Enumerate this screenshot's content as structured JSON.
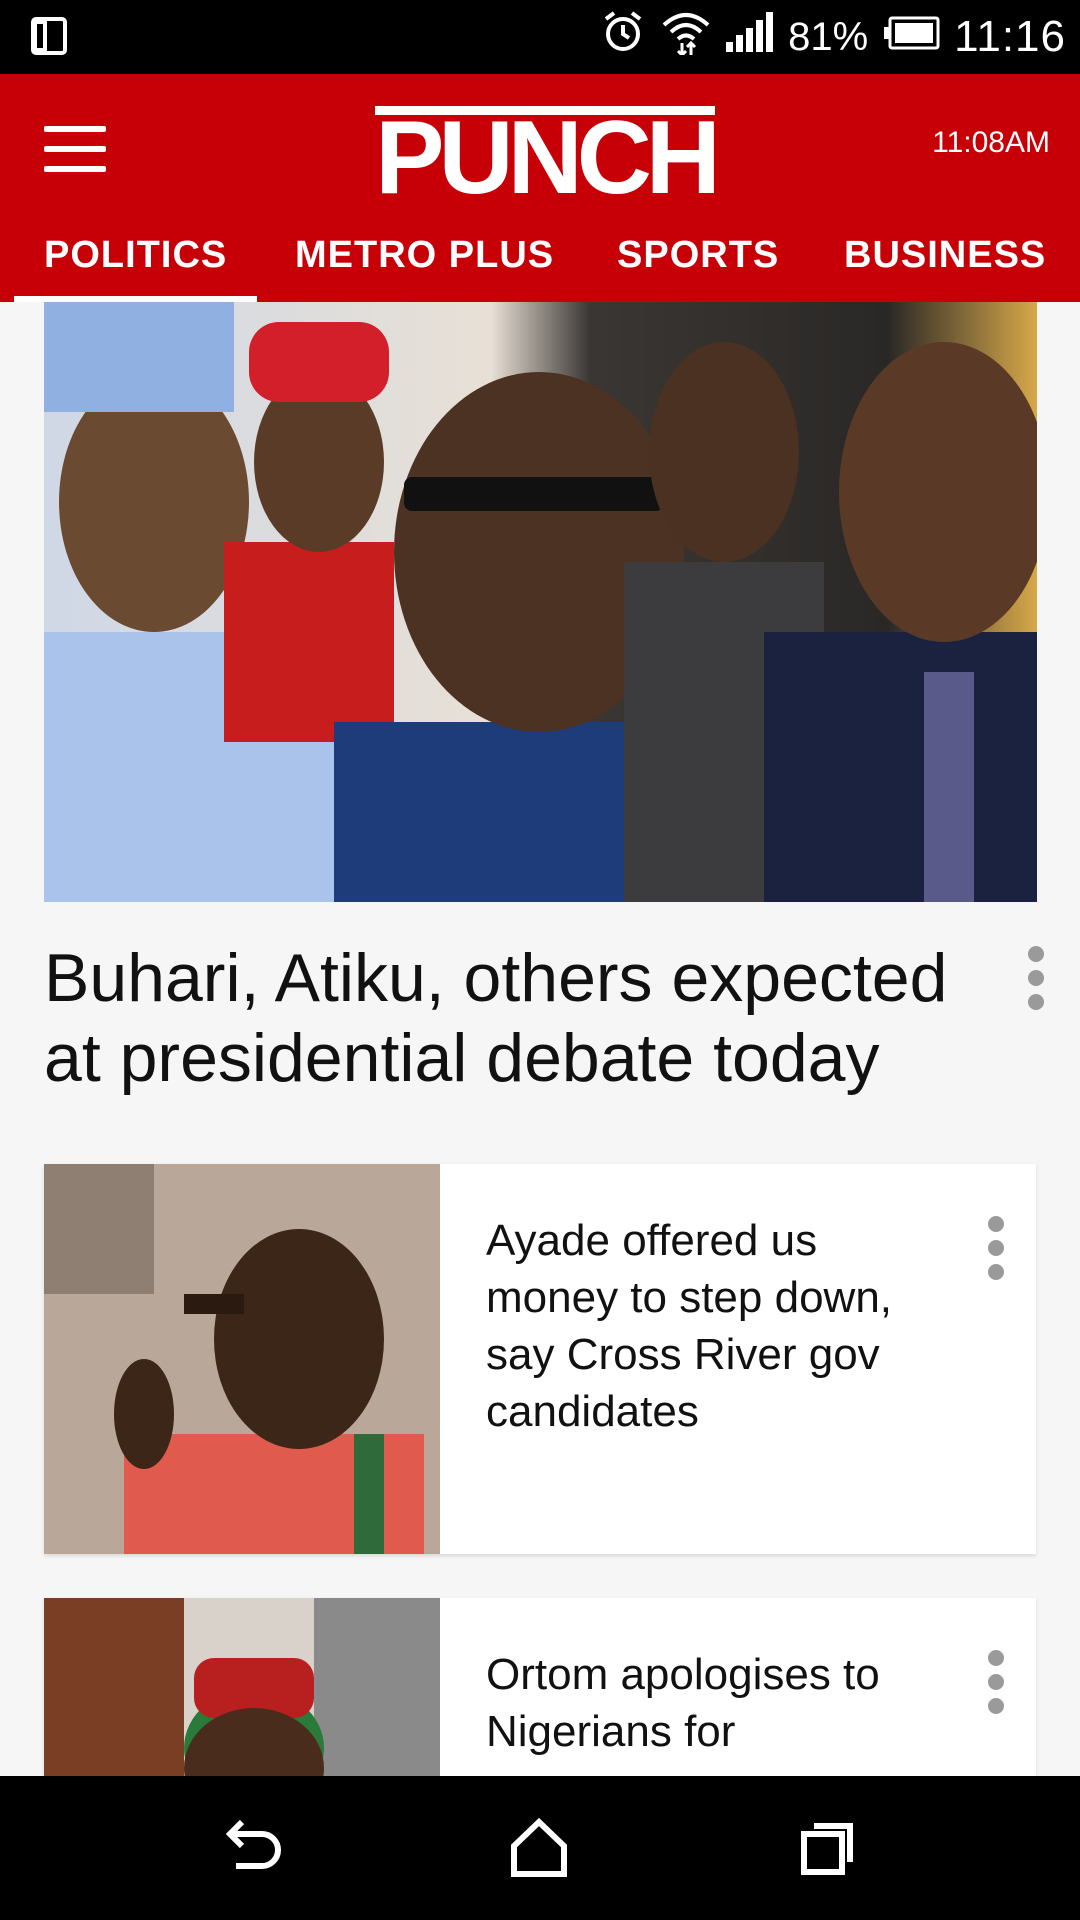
{
  "status_bar": {
    "battery_percent": "81%",
    "time": "11:16",
    "icons": [
      "tablet-icon",
      "alarm-icon",
      "wifi-icon",
      "signal-icon",
      "battery-icon"
    ]
  },
  "header": {
    "logo": "PUNCH",
    "time": "11:08AM",
    "brand_color": "#c70007"
  },
  "tabs": [
    {
      "label": "POLITICS",
      "active": true
    },
    {
      "label": "METRO PLUS",
      "active": false
    },
    {
      "label": "SPORTS",
      "active": false
    },
    {
      "label": "BUSINESS",
      "active": false
    }
  ],
  "hero": {
    "title": "Buhari, Atiku, others expected at presidential debate today"
  },
  "articles": [
    {
      "title": "Ayade offered us money to step down, say Cross River gov candidates"
    },
    {
      "title": "Ortom apologises to Nigerians for"
    }
  ],
  "nav_bar": {
    "icons": [
      "back-icon",
      "home-icon",
      "recent-apps-icon"
    ]
  }
}
